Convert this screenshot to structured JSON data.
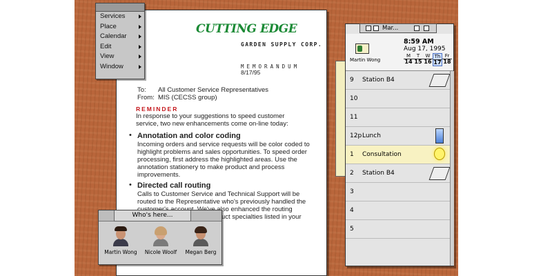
{
  "menu": {
    "items": [
      {
        "label": "Services"
      },
      {
        "label": "Place"
      },
      {
        "label": "Calendar"
      },
      {
        "label": "Edit"
      },
      {
        "label": "View"
      },
      {
        "label": "Window"
      }
    ]
  },
  "memo": {
    "company": "CUTTING EDGE",
    "subtitle": "GARDEN SUPPLY CORP.",
    "heading": "MEMORANDUM",
    "date": "8/17/95",
    "to_label": "To:",
    "to": "All Customer Service Representatives",
    "from_label": "From:",
    "from": "MIS (CECSS group)",
    "reminder": "REMINDER",
    "intro": "In response to your suggestions to speed customer service, two new enhancements come on-line today:",
    "bullets": [
      {
        "title": "Annotation and color coding",
        "body": "Incoming orders and service requests will be color coded to highlight problems and sales opportunities. To speed order processing, first address the highlighted areas. Use the annotation stationery to make product and process improvements."
      },
      {
        "title": "Directed call routing",
        "body": "Calls to Customer Service and Technical Support will be routed to the Representative who's previously handled the customer's account. We've also enhanced the routing system to recognize the product specialties listed in your business card."
      }
    ]
  },
  "who": {
    "title": "Who's here...",
    "people": [
      {
        "name": "Martin Wong"
      },
      {
        "name": "Nicole Woolf"
      },
      {
        "name": "Megan Berg"
      }
    ]
  },
  "organizer": {
    "title": "Mar...",
    "owner": "Martin Wong",
    "time": "8:59 AM",
    "date": "Aug 17, 1995",
    "days": [
      {
        "d": "M",
        "n": "14"
      },
      {
        "d": "T",
        "n": "15"
      },
      {
        "d": "W",
        "n": "16"
      },
      {
        "d": "Th",
        "n": "17"
      },
      {
        "d": "Fr",
        "n": "18"
      }
    ],
    "slots": [
      {
        "hour": "9",
        "label": "Station B4"
      },
      {
        "hour": "10",
        "label": ""
      },
      {
        "hour": "11",
        "label": ""
      },
      {
        "hour": "12p",
        "label": "Lunch"
      },
      {
        "hour": "1",
        "label": "Consultation"
      },
      {
        "hour": "2",
        "label": "Station B4"
      },
      {
        "hour": "3",
        "label": ""
      },
      {
        "hour": "4",
        "label": ""
      },
      {
        "hour": "5",
        "label": ""
      }
    ]
  },
  "colors": {
    "desk": "#b9663b",
    "logo": "#1b8a35",
    "reminder": "#c4161b",
    "highlight": "#f8f2c2"
  }
}
